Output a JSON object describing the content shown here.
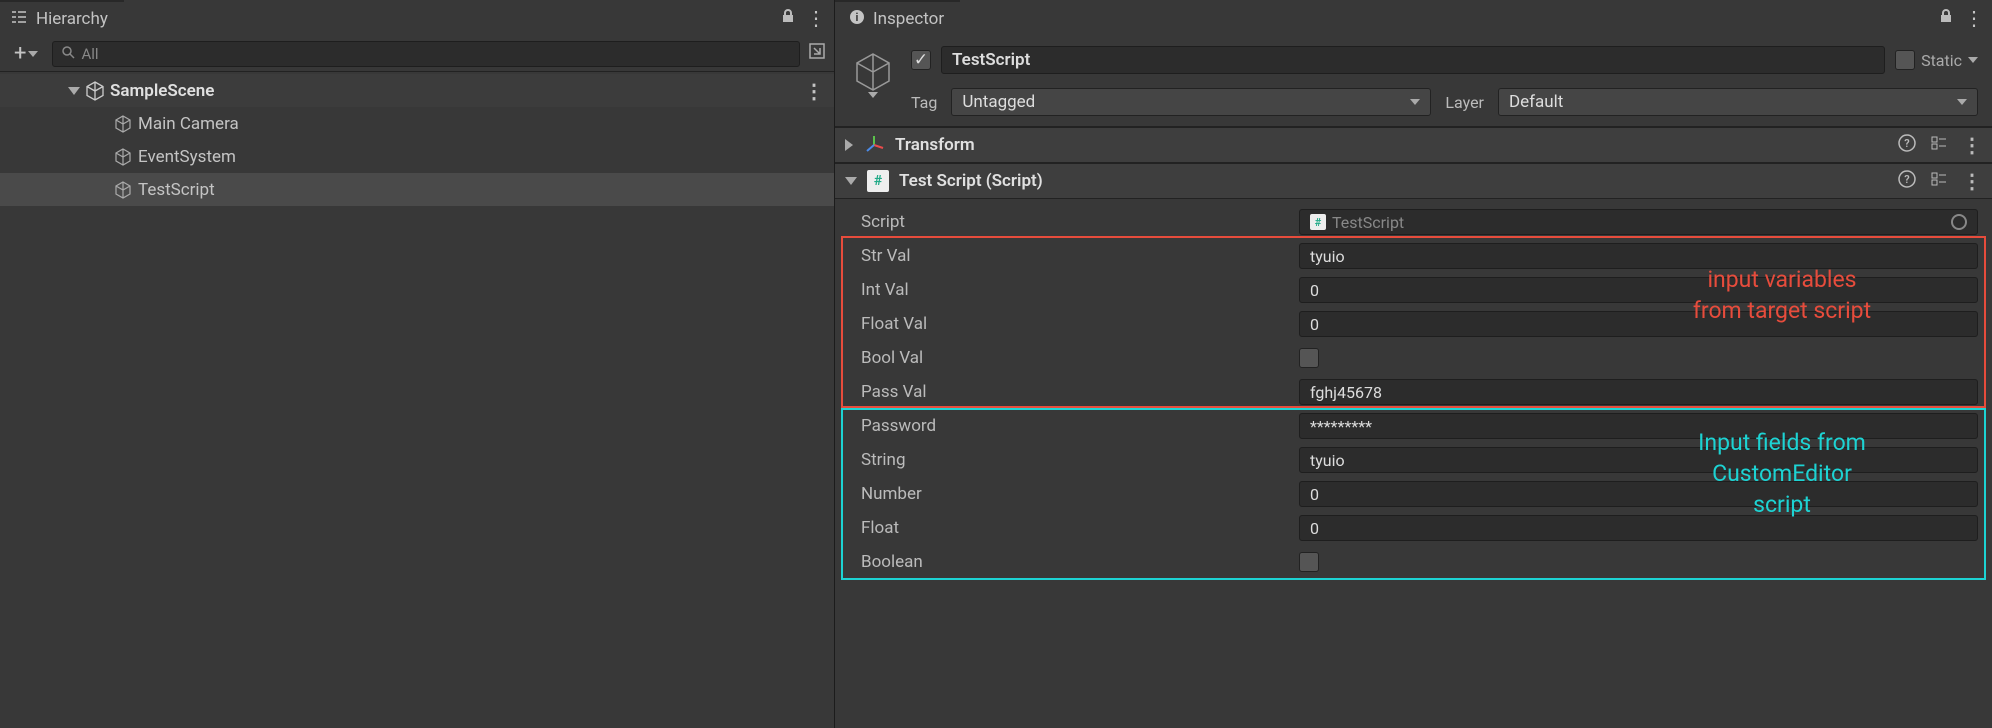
{
  "hierarchy": {
    "tab_label": "Hierarchy",
    "search_placeholder": "All",
    "scene_name": "SampleScene",
    "items": [
      {
        "label": "Main Camera"
      },
      {
        "label": "EventSystem"
      },
      {
        "label": "TestScript"
      }
    ]
  },
  "inspector": {
    "tab_label": "Inspector",
    "go_name": "TestScript",
    "go_enabled": true,
    "static_label": "Static",
    "tag_label": "Tag",
    "tag_value": "Untagged",
    "layer_label": "Layer",
    "layer_value": "Default",
    "components": {
      "transform": {
        "title": "Transform"
      },
      "script": {
        "title": "Test Script (Script)",
        "script_field_label": "Script",
        "script_field_value": "TestScript",
        "target_fields": [
          {
            "label": "Str Val",
            "value": "tyuio",
            "type": "text"
          },
          {
            "label": "Int Val",
            "value": "0",
            "type": "text"
          },
          {
            "label": "Float Val",
            "value": "0",
            "type": "text"
          },
          {
            "label": "Bool Val",
            "value": "",
            "type": "bool"
          },
          {
            "label": "Pass Val",
            "value": "fghj45678",
            "type": "text"
          }
        ],
        "editor_fields": [
          {
            "label": "Password",
            "value": "*********",
            "type": "text"
          },
          {
            "label": "String",
            "value": "tyuio",
            "type": "text"
          },
          {
            "label": "Number",
            "value": "0",
            "type": "text"
          },
          {
            "label": "Float",
            "value": "0",
            "type": "text"
          },
          {
            "label": "Boolean",
            "value": "",
            "type": "bool"
          }
        ]
      }
    }
  },
  "annotations": {
    "red_text_l1": "input variables",
    "red_text_l2": "from target script",
    "cyan_text_l1": "Input fields from",
    "cyan_text_l2": "CustomEditor",
    "cyan_text_l3": "script"
  }
}
